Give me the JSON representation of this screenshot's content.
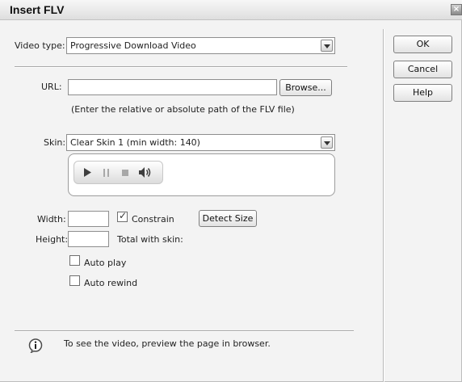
{
  "window": {
    "title": "Insert FLV",
    "close_glyph": "×"
  },
  "video_type": {
    "label": "Video type:",
    "value": "Progressive Download Video"
  },
  "url": {
    "label": "URL:",
    "value": "",
    "browse_label": "Browse...",
    "hint": "(Enter the relative or absolute path of the FLV file)"
  },
  "skin": {
    "label": "Skin:",
    "value": "Clear Skin 1 (min width: 140)",
    "controls": [
      "play-icon",
      "pause-icon",
      "stop-icon",
      "volume-icon"
    ]
  },
  "width": {
    "label": "Width:",
    "value": "",
    "constrain_label": "Constrain",
    "constrain_checked": true,
    "detect_label": "Detect Size"
  },
  "height": {
    "label": "Height:",
    "value": "",
    "total_label": "Total with skin:"
  },
  "options": {
    "autoplay_label": "Auto play",
    "autoplay_checked": false,
    "autorewind_label": "Auto rewind",
    "autorewind_checked": false
  },
  "buttons": {
    "ok": "OK",
    "cancel": "Cancel",
    "help": "Help"
  },
  "footer": {
    "message": "To see the video, preview the page in browser.",
    "icon": "info-icon"
  },
  "colors": {
    "dialog_bg": "#f3f3f3",
    "icon_dark": "#4a4a4a"
  }
}
